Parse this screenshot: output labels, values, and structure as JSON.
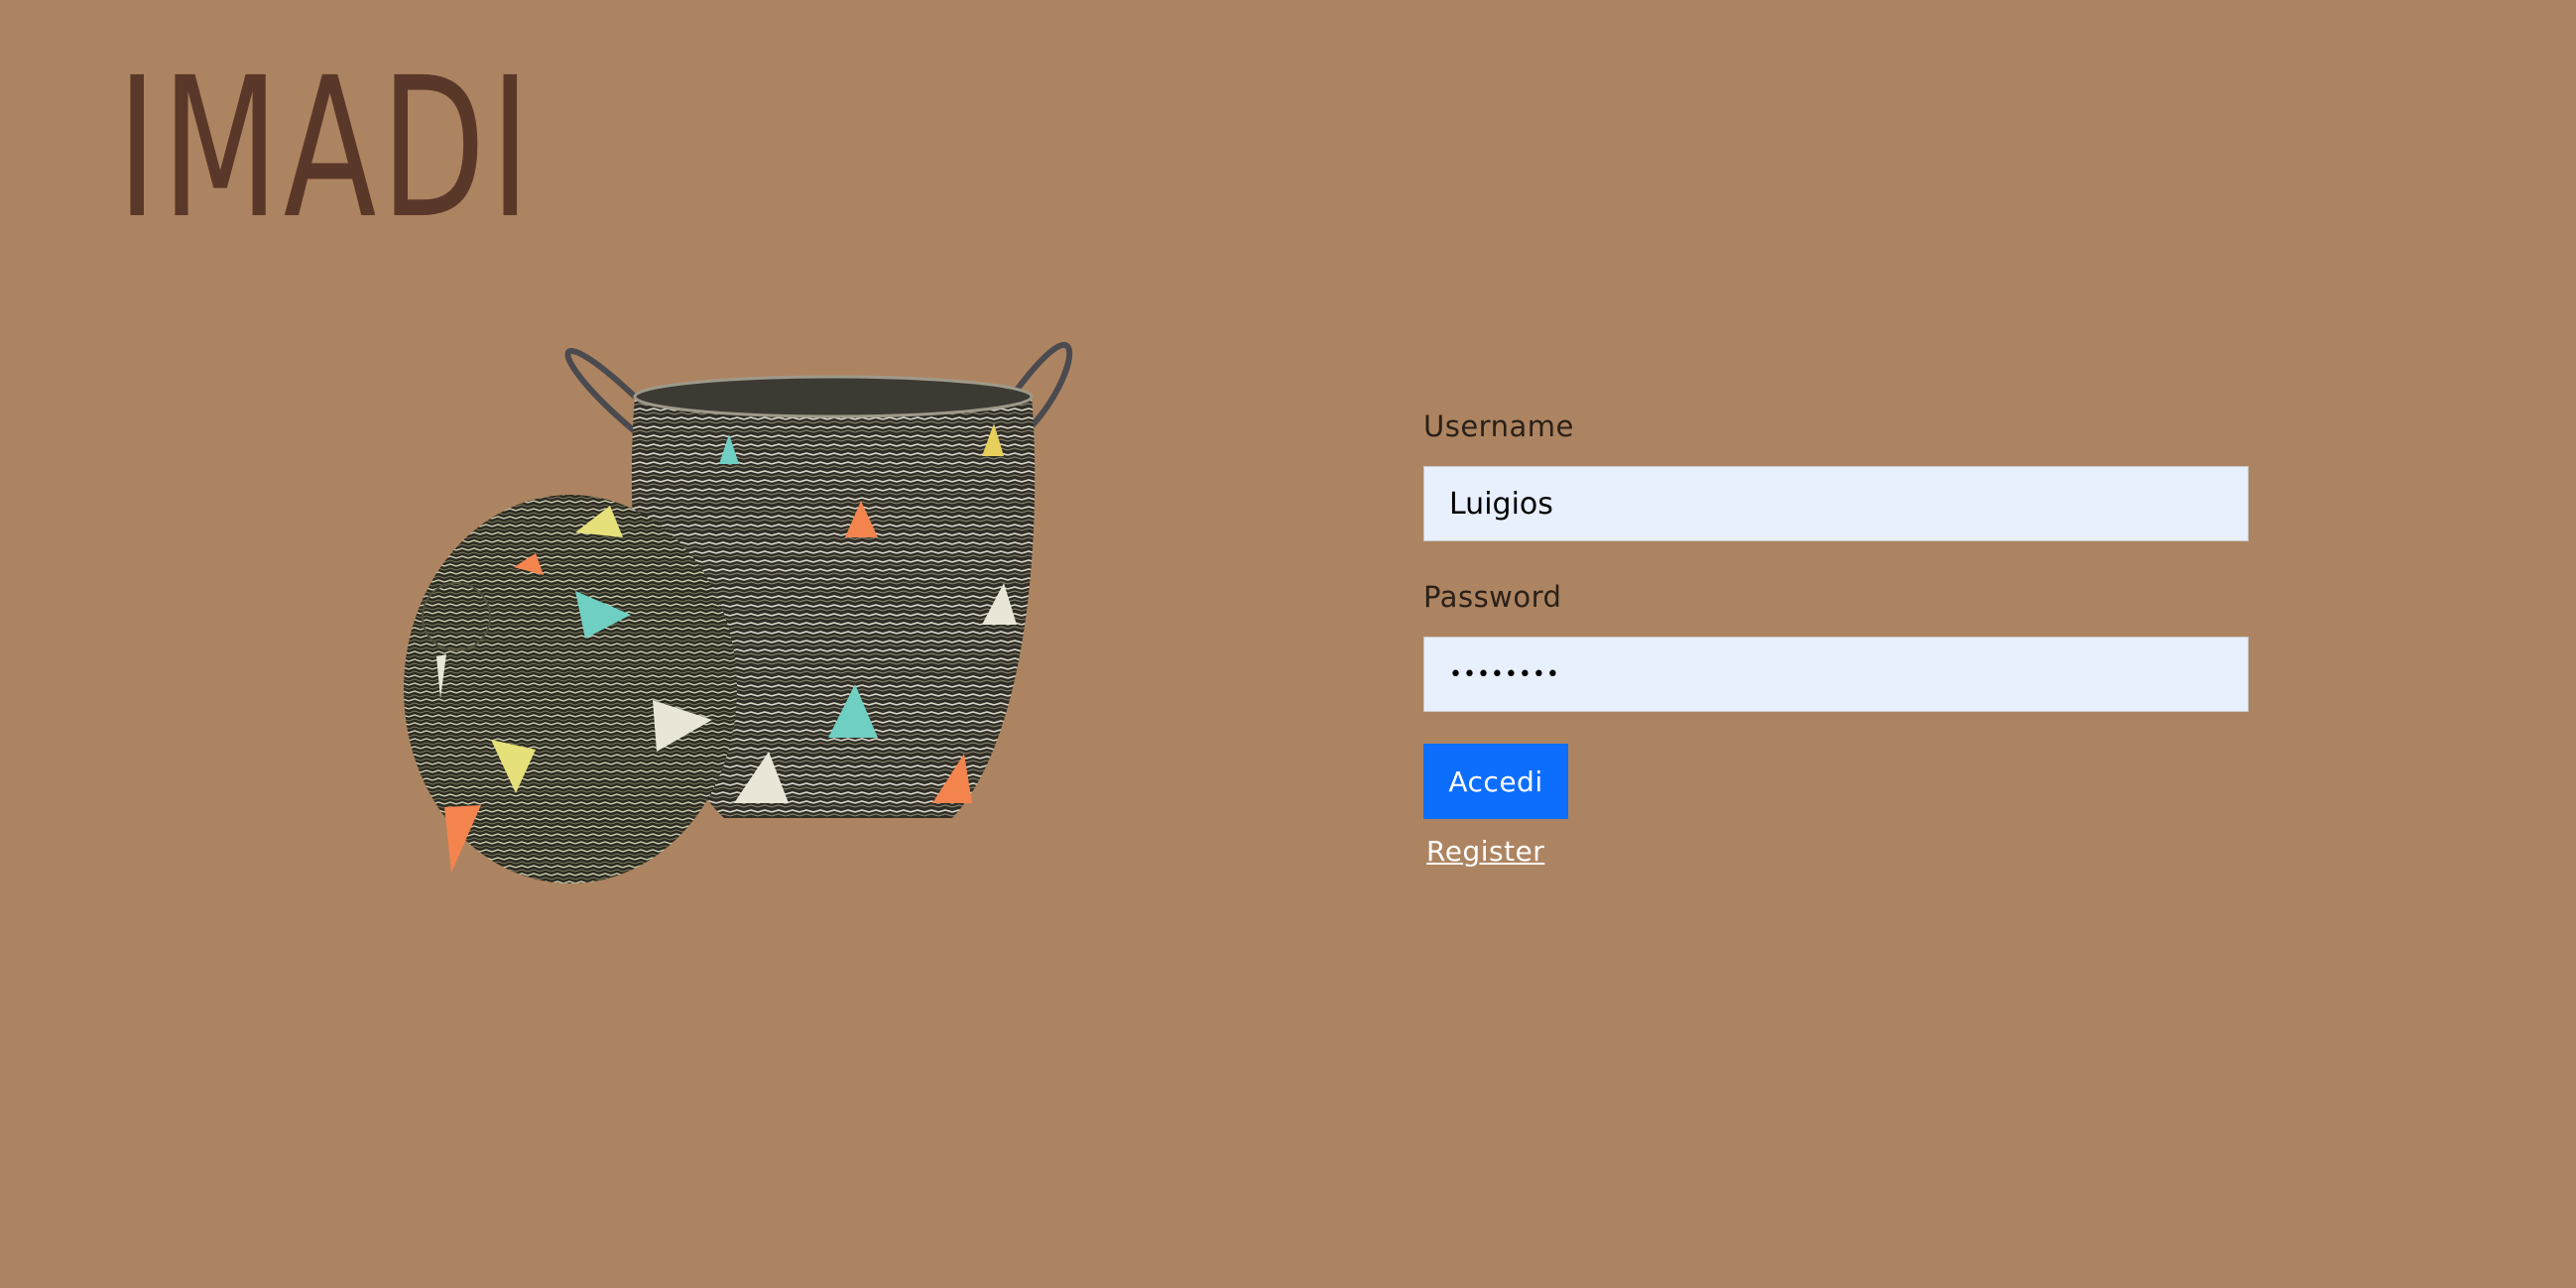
{
  "app": {
    "logo_text": "IMADI"
  },
  "colors": {
    "background": "#ad8461",
    "logo": "#5a3829",
    "input_bg": "#e8f0fe",
    "button_bg": "#0d6efd",
    "link": "#ffffff"
  },
  "hero": {
    "image": "woven-basket-with-lid-illustration"
  },
  "login_form": {
    "username_label": "Username",
    "username_value": "Luigios",
    "password_label": "Password",
    "password_value": "••••••••",
    "submit_label": "Accedi",
    "register_label": "Register"
  }
}
